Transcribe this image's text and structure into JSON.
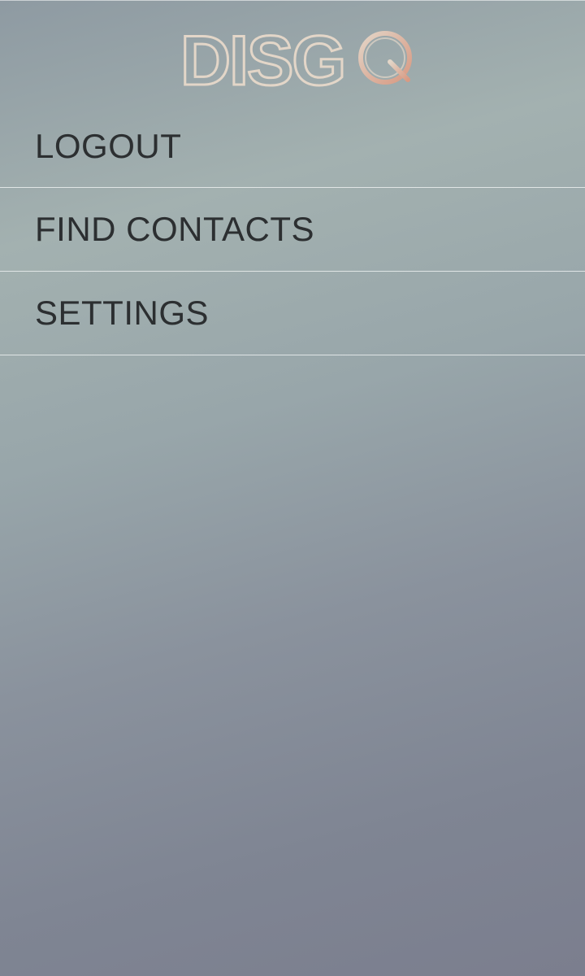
{
  "brand": {
    "logo_text": "DISGO",
    "outline_color": "#e3d6c8",
    "accent_color": "#d89a83"
  },
  "menu": {
    "items": [
      {
        "id": "logout",
        "label": "LOGOUT"
      },
      {
        "id": "find-contacts",
        "label": "FIND CONTACTS"
      },
      {
        "id": "settings",
        "label": "SETTINGS"
      }
    ]
  },
  "colors": {
    "text": "#2c2f31",
    "divider": "#ebeeee"
  }
}
